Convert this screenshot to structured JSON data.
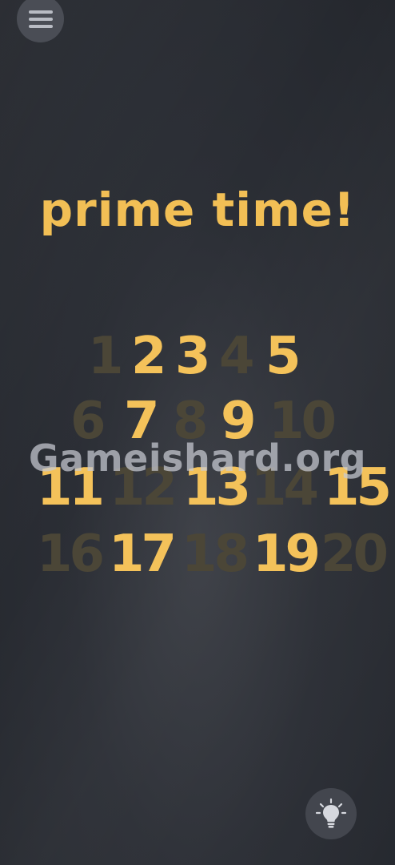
{
  "header": {
    "menu_icon": "hamburger-menu-icon"
  },
  "puzzle": {
    "title": "prime time!"
  },
  "grid": {
    "rows": [
      [
        {
          "label": "1",
          "highlighted": false
        },
        {
          "label": "2",
          "highlighted": true
        },
        {
          "label": "3",
          "highlighted": true
        },
        {
          "label": "4",
          "highlighted": false
        },
        {
          "label": "5",
          "highlighted": true
        }
      ],
      [
        {
          "label": "6",
          "highlighted": false
        },
        {
          "label": "7",
          "highlighted": true
        },
        {
          "label": "8",
          "highlighted": false
        },
        {
          "label": "9",
          "highlighted": true
        },
        {
          "label": "10",
          "highlighted": false
        }
      ],
      [
        {
          "label": "11",
          "highlighted": true
        },
        {
          "label": "12",
          "highlighted": false
        },
        {
          "label": "13",
          "highlighted": true
        },
        {
          "label": "14",
          "highlighted": false
        },
        {
          "label": "15",
          "highlighted": true
        }
      ],
      [
        {
          "label": "16",
          "highlighted": false
        },
        {
          "label": "17",
          "highlighted": true
        },
        {
          "label": "18",
          "highlighted": false
        },
        {
          "label": "19",
          "highlighted": true
        },
        {
          "label": "20",
          "highlighted": false
        }
      ]
    ]
  },
  "watermark": {
    "text": "Gameishard.org"
  },
  "footer": {
    "hint_icon": "lightbulb-hint-icon"
  },
  "colors": {
    "highlight": "#f4c25a",
    "dim": "#4b4637",
    "background": "#2b2e35"
  }
}
